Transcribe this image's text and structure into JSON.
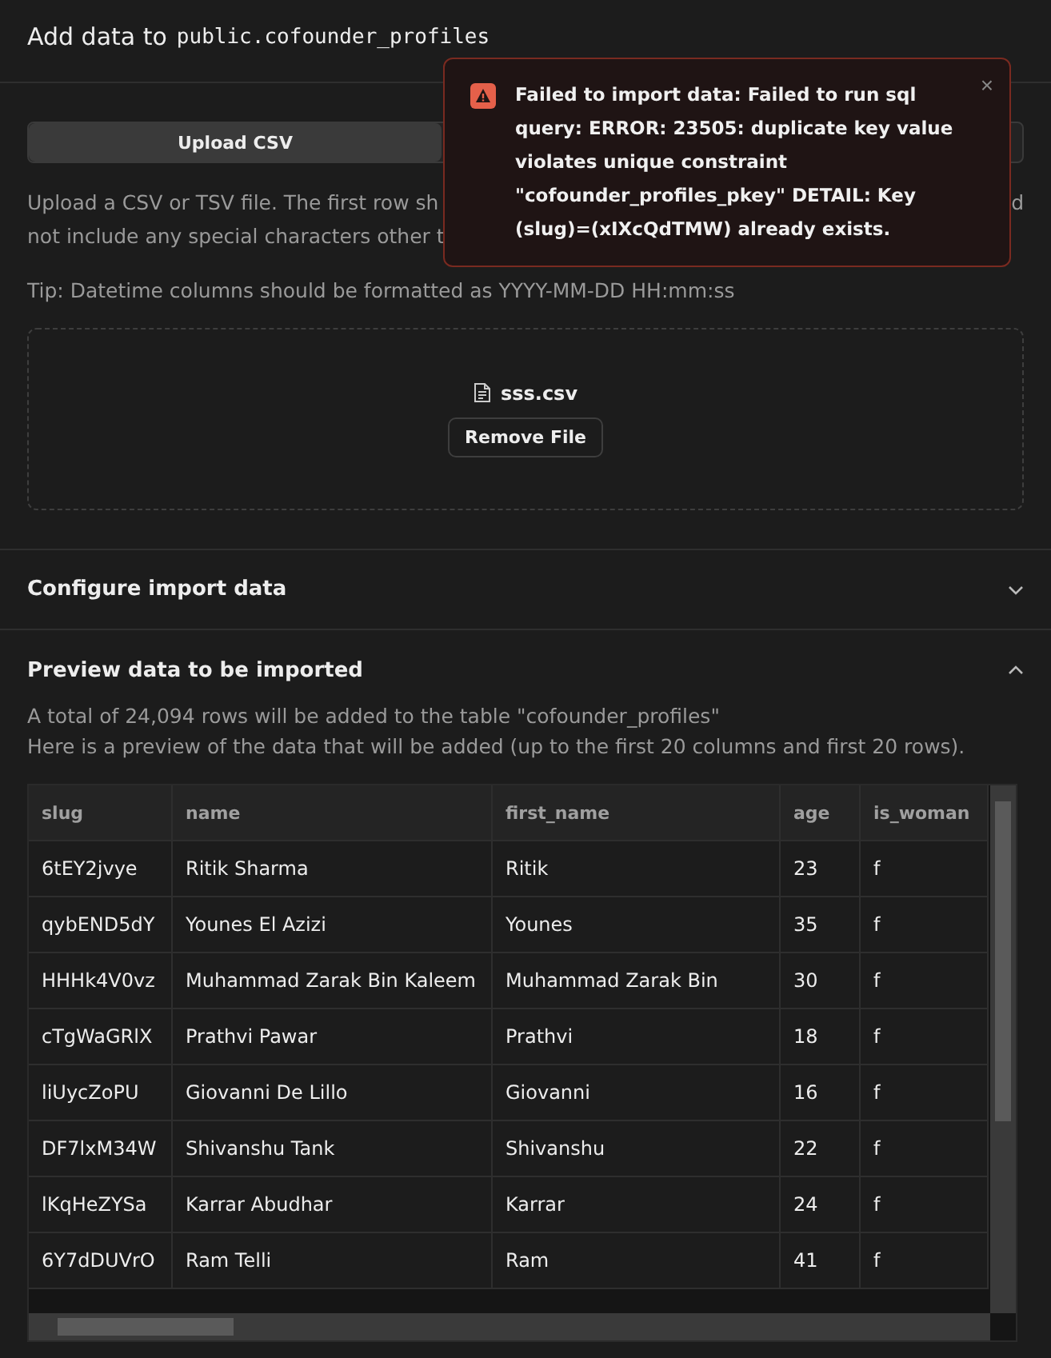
{
  "header": {
    "title": "Add data to",
    "table_name": "public.cofounder_profiles"
  },
  "upload_tab": {
    "label": "Upload CSV"
  },
  "description_lines": [
    {
      "left": "Upload a CSV or TSV file. The first row sh",
      "right": "d"
    },
    {
      "left": "not include any special characters other t"
    }
  ],
  "tip": "Tip: Datetime columns should be formatted as YYYY-MM-DD HH:mm:ss",
  "dropzone": {
    "file_name": "sss.csv",
    "remove_button": "Remove File"
  },
  "sections": [
    {
      "title": "Configure import data",
      "expanded": false
    },
    {
      "title": "Preview data to be imported",
      "expanded": true
    }
  ],
  "preview": {
    "summary": "A total of 24,094 rows will be added to the table \"cofounder_profiles\"",
    "note": "Here is a preview of the data that will be added (up to the first 20 columns and first 20 rows).",
    "table": {
      "columns": [
        "slug",
        "name",
        "first_name",
        "age",
        "is_woman"
      ],
      "rows": [
        [
          "6tEY2jvye",
          "Ritik Sharma",
          "Ritik",
          "23",
          "f"
        ],
        [
          "qybEND5dY",
          "Younes El Azizi",
          "Younes",
          "35",
          "f"
        ],
        [
          "HHHk4V0vz",
          "Muhammad Zarak Bin Kaleem",
          "Muhammad Zarak Bin",
          "30",
          "f"
        ],
        [
          "cTgWaGRlX",
          "Prathvi Pawar",
          "Prathvi",
          "18",
          "f"
        ],
        [
          "liUycZoPU",
          "Giovanni De Lillo",
          "Giovanni",
          "16",
          "f"
        ],
        [
          "DF7lxM34W",
          "Shivanshu Tank",
          "Shivanshu",
          "22",
          "f"
        ],
        [
          "lKqHeZYSa",
          "Karrar Abudhar",
          "Karrar",
          "24",
          "f"
        ],
        [
          "6Y7dDUVrO",
          "Ram Telli",
          "Ram",
          "41",
          "f"
        ]
      ]
    }
  },
  "toast": {
    "kind": "error",
    "message": "Failed to import data: Failed to run sql query: ERROR: 23505: duplicate key value violates unique constraint \"cofounder_profiles_pkey\" DETAIL: Key (slug)=(xIXcQdTMW) already exists.",
    "close": "×"
  }
}
